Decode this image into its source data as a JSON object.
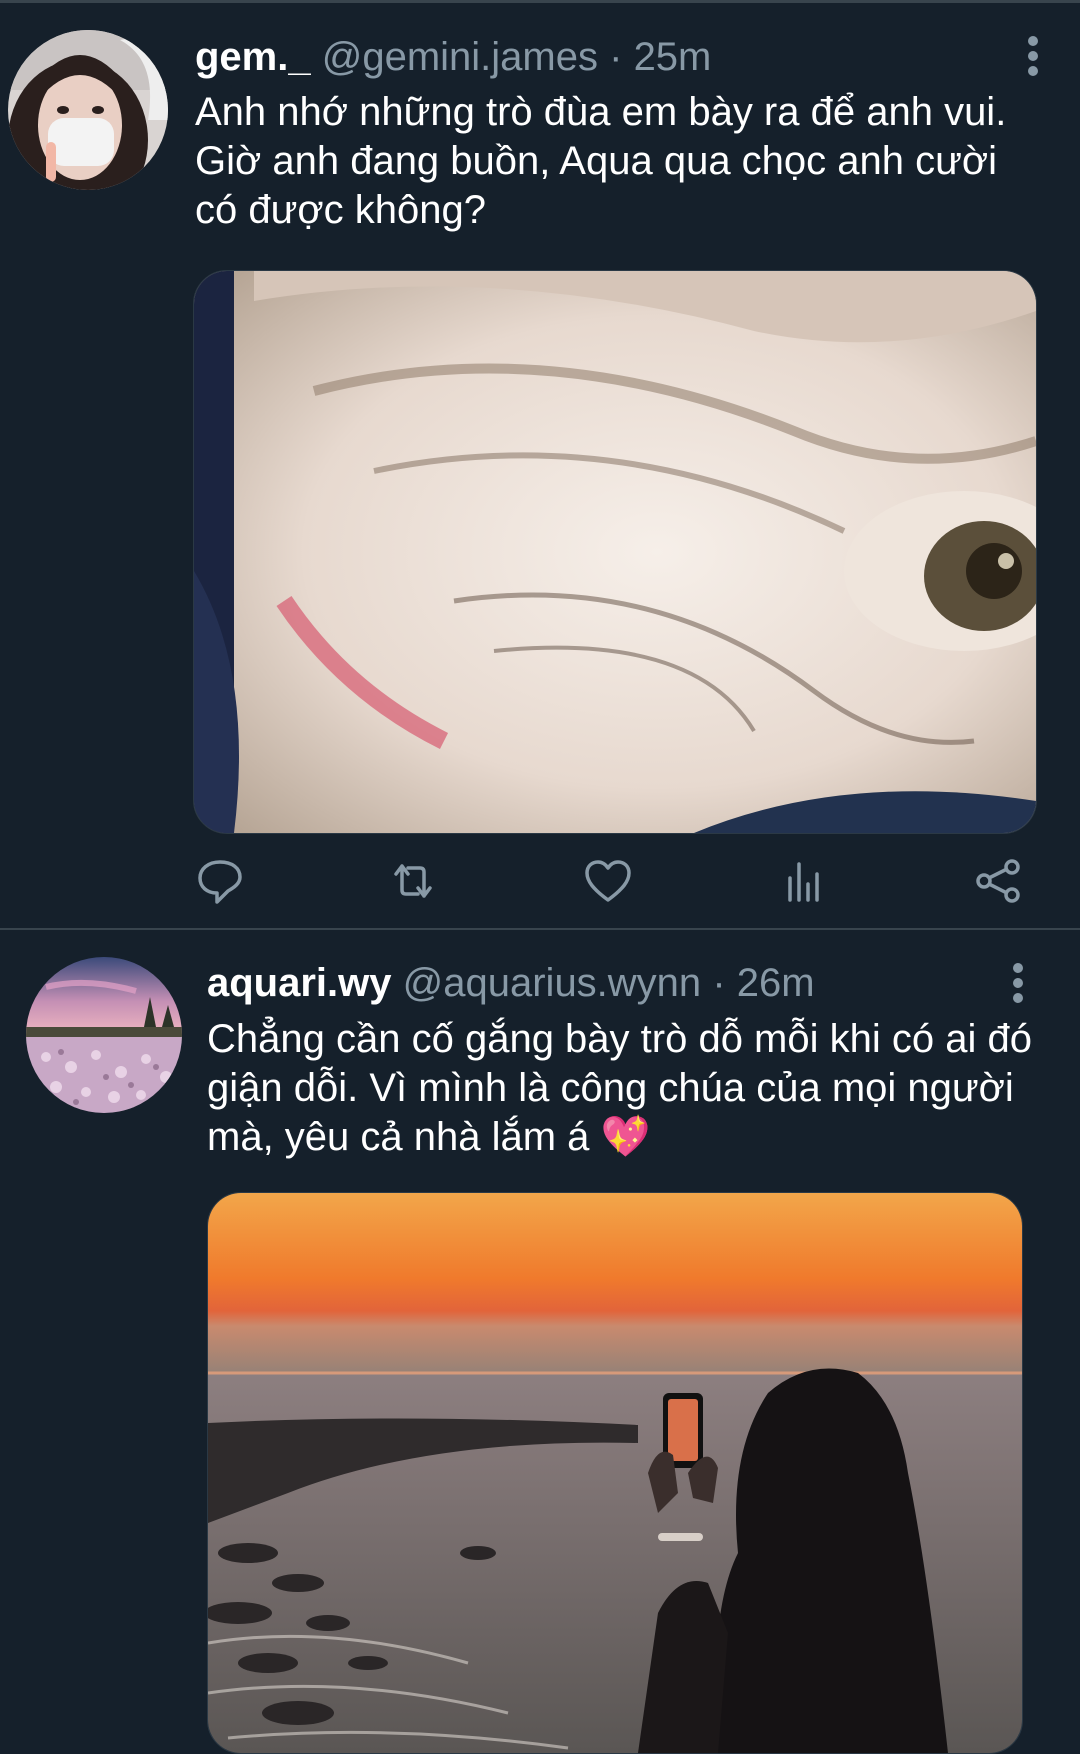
{
  "tweets": [
    {
      "display_name": "gem._",
      "handle": "@gemini.james",
      "separator": "·",
      "time": "25m",
      "text": "Anh nhớ những trò đùa em bày ra để anh vui. Giờ anh đang buồn, Aqua qua chọc anh cười có được không?",
      "avatar_icon": "person-avatar-icon",
      "media": "photo-closeup-face",
      "actions": [
        "reply-icon",
        "retweet-icon",
        "like-icon",
        "analytics-icon",
        "share-icon"
      ]
    },
    {
      "display_name": "aquari.wy",
      "handle": "@aquarius.wynn",
      "separator": "·",
      "time": "26m",
      "text": "Chẳng cần cố gắng bày trò dỗ mỗi khi có ai đó giận dỗi. Vì mình là công chúa của mọi người mà, yêu cả nhà lắm á 💖",
      "avatar_icon": "landscape-avatar-icon",
      "media": "photo-sunset-beach"
    }
  ],
  "colors": {
    "background": "#15202b",
    "divider": "#38444d",
    "secondary_text": "#8899a6",
    "primary_text": "#ffffff"
  }
}
